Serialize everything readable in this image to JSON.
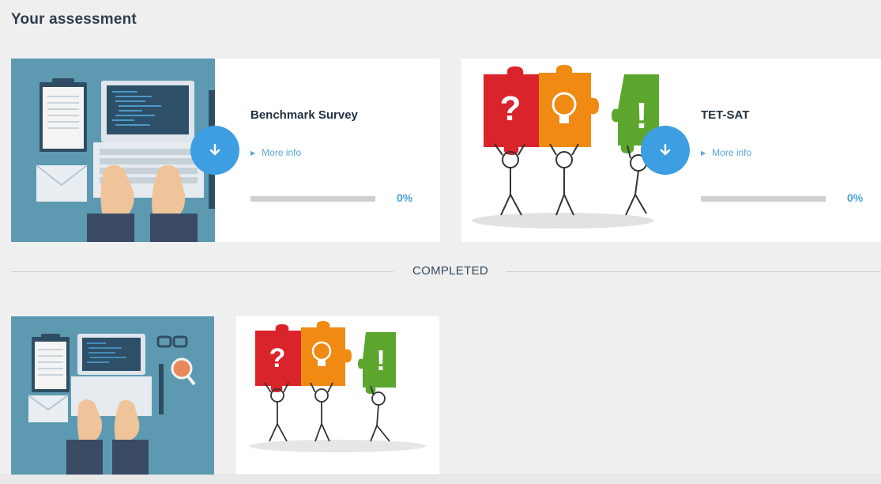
{
  "page": {
    "title": "Your assessment"
  },
  "assessments": [
    {
      "title": "Benchmark Survey",
      "more_info": "More info",
      "progress": 0,
      "progress_label": "0%",
      "image": "laptop-workspace-illustration"
    },
    {
      "title": "TET-SAT",
      "more_info": "More info",
      "progress": 0,
      "progress_label": "0%",
      "image": "puzzle-pieces-illustration"
    }
  ],
  "completed": {
    "label": "COMPLETED",
    "items": [
      {
        "image": "laptop-workspace-search-illustration"
      },
      {
        "image": "puzzle-pieces-illustration"
      }
    ]
  },
  "icons": {
    "download": "download-arrow-icon",
    "more_info_arrow": "triangle-right-icon"
  },
  "colors": {
    "accent": "#3d9ee2",
    "illustration_bg": "#5d9ab2",
    "puzzle_red": "#d9242b",
    "puzzle_orange": "#f08a12",
    "puzzle_green": "#5ca62e"
  }
}
